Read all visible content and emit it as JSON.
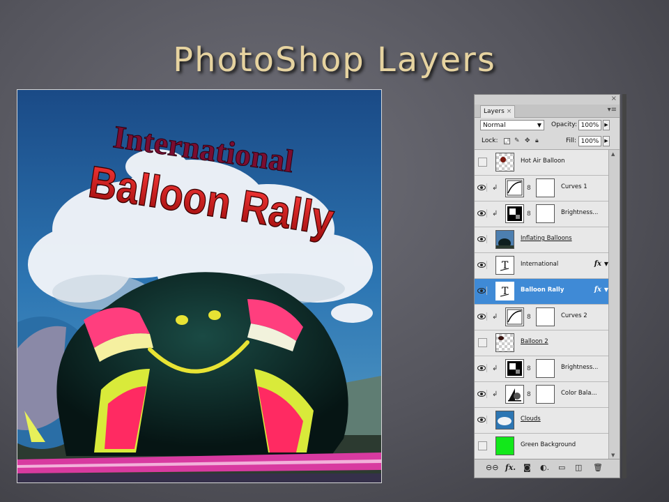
{
  "slide": {
    "title": "PhotoShop Layers"
  },
  "artwork": {
    "line1": "International",
    "line2": "Balloon Rally"
  },
  "layers_panel": {
    "tab_label": "Layers",
    "tab_close": "×",
    "panel_close": "×",
    "panel_collapse": "«",
    "menu_icon": "▾≡",
    "blend_mode": "Normal",
    "opacity_label": "Opacity:",
    "opacity_value": "100%",
    "lock_label": "Lock:",
    "fill_label": "Fill:",
    "fill_value": "100%",
    "layers": [
      {
        "name": "Hot Air Balloon",
        "visible": false,
        "selected": false
      },
      {
        "name": "Curves 1",
        "visible": true,
        "selected": false
      },
      {
        "name": "Brightness...",
        "visible": true,
        "selected": false
      },
      {
        "name": "Inflating Balloons",
        "visible": true,
        "selected": false
      },
      {
        "name": "International",
        "visible": true,
        "selected": false,
        "fx": "fx"
      },
      {
        "name": "Balloon Rally",
        "visible": true,
        "selected": true,
        "fx": "fx"
      },
      {
        "name": "Curves 2",
        "visible": true,
        "selected": false
      },
      {
        "name": "Balloon 2",
        "visible": false,
        "selected": false
      },
      {
        "name": "Brightness...",
        "visible": true,
        "selected": false
      },
      {
        "name": "Color Bala...",
        "visible": true,
        "selected": false
      },
      {
        "name": "Clouds",
        "visible": true,
        "selected": false
      },
      {
        "name": "Green Background",
        "visible": false,
        "selected": false
      }
    ]
  },
  "colors": {
    "title": "#e6d3a0",
    "selection": "#3f8ad6",
    "green_layer": "#12e81a"
  }
}
